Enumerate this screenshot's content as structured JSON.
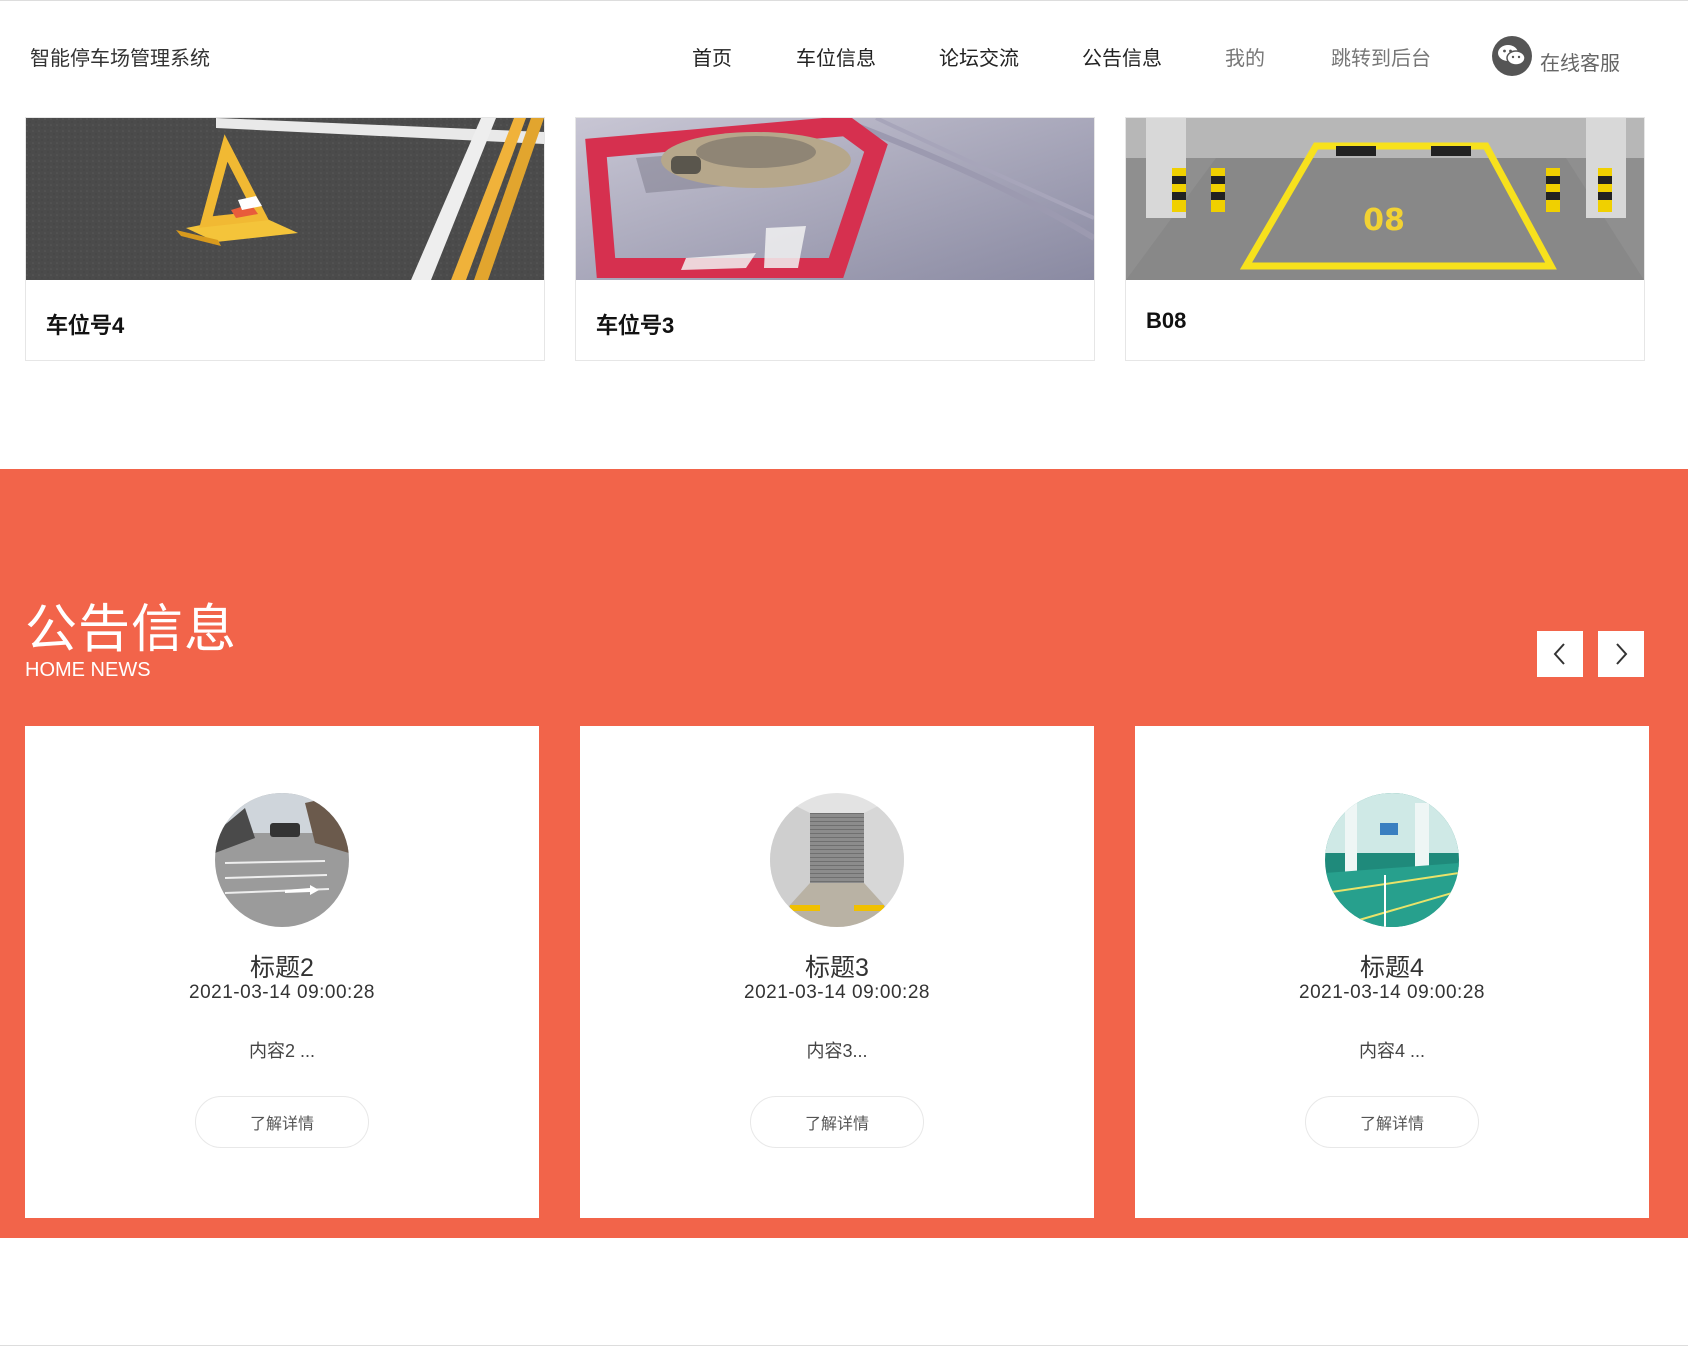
{
  "header": {
    "site_title": "智能停车场管理系统",
    "nav": [
      {
        "label": "首页"
      },
      {
        "label": "车位信息"
      },
      {
        "label": "论坛交流"
      },
      {
        "label": "公告信息"
      },
      {
        "label": "我的"
      },
      {
        "label": "跳转到后台"
      }
    ],
    "customer_service": {
      "label": "在线客服",
      "icon": "wechat-icon"
    }
  },
  "parking": {
    "items": [
      {
        "name": "车位号4",
        "image": "parking-lock-photo"
      },
      {
        "name": "车位号3",
        "image": "car-on-red-bay-photo"
      },
      {
        "name": "B08",
        "image": "yellow-bay-08-photo"
      }
    ]
  },
  "news": {
    "title": "公告信息",
    "subtitle": "HOME NEWS",
    "prev_icon": "chevron-left-icon",
    "next_icon": "chevron-right-icon",
    "accent_color": "#f2644a",
    "items": [
      {
        "title": "标题2",
        "date": "2021-03-14 09:00:28",
        "content": "内容2 ...",
        "button": "了解详情",
        "image": "street-parking-photo"
      },
      {
        "title": "标题3",
        "date": "2021-03-14 09:00:28",
        "content": "内容3...",
        "button": "了解详情",
        "image": "garage-door-photo"
      },
      {
        "title": "标题4",
        "date": "2021-03-14 09:00:28",
        "content": "内容4 ...",
        "button": "了解详情",
        "image": "green-garage-photo"
      }
    ]
  }
}
